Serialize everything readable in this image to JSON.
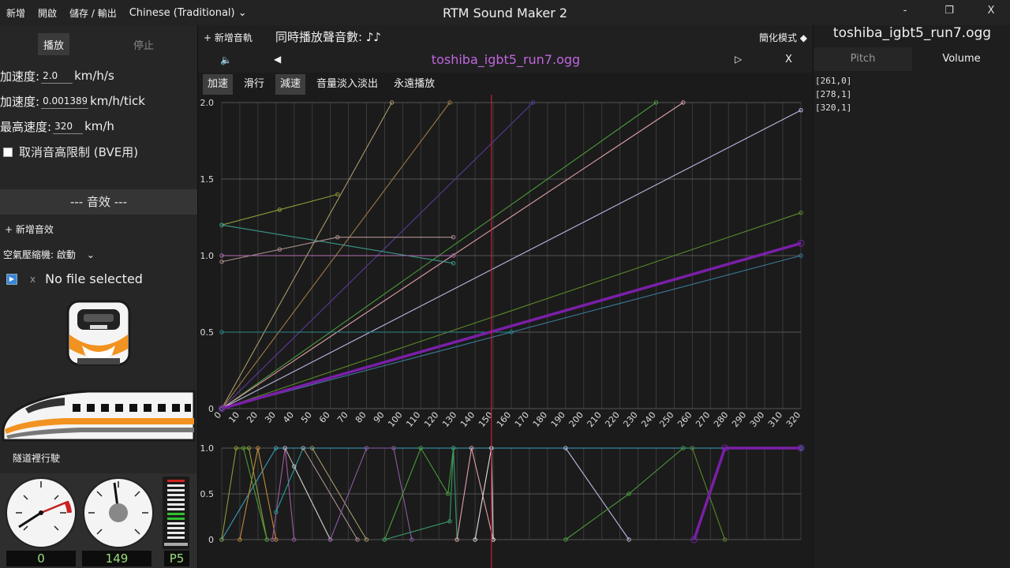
{
  "menu": {
    "new": "新增",
    "open": "開啟",
    "save": "儲存 / 輸出",
    "language": "Chinese (Traditional)"
  },
  "app_title": "RTM Sound Maker 2",
  "window": {
    "minimize": "-",
    "maximize": "❐",
    "close": "X"
  },
  "left": {
    "play": "播放",
    "stop": "停止",
    "accel_label": "加速度:",
    "accel_value": "2.0",
    "accel_unit": "km/h/s",
    "accel_tick_label": "加速度:",
    "accel_tick_value": "0.001389",
    "accel_tick_unit": "km/h/tick",
    "max_speed_label": "最高速度:",
    "max_speed_value": "320",
    "max_speed_unit": "km/h",
    "pitch_limit_label": "取消音高限制 (BVE用)",
    "sfx_header": "--- 音效 ---",
    "add_sfx": "+ 新增音效",
    "sfx_select": "空氣壓縮機: 啟動",
    "file_x": "x",
    "no_file": "No file selected",
    "tunnel": "隧道裡行駛",
    "readouts": [
      "0",
      "149",
      "P5"
    ]
  },
  "center": {
    "add_track": "+ 新增音軌",
    "polyphony": "同時播放聲音數: ♪♪",
    "simple_mode": "簡化模式 ◆",
    "prev": "◀",
    "next": "▷",
    "close": "X",
    "file_title": "toshiba_igbt5_run7.ogg",
    "tabs": [
      "加速",
      "滑行",
      "減速",
      "音量淡入淡出",
      "永遠播放"
    ]
  },
  "right": {
    "title": "toshiba_igbt5_run7.ogg",
    "tab_pitch": "Pitch",
    "tab_volume": "Volume",
    "points": [
      "[261,0]",
      "[278,1]",
      "[320,1]"
    ]
  },
  "colors": {
    "highlight": "#7a1fa8",
    "cursor": "#c0203a",
    "title": "#c066e0"
  },
  "chart_data": [
    {
      "type": "line",
      "title": "",
      "xlabel": "",
      "ylabel": "",
      "xlim": [
        0,
        320
      ],
      "ylim": [
        0,
        2.0
      ],
      "x_ticks": [
        0,
        10,
        20,
        30,
        40,
        50,
        60,
        70,
        80,
        90,
        100,
        110,
        120,
        130,
        140,
        150,
        160,
        170,
        180,
        190,
        200,
        210,
        220,
        230,
        240,
        250,
        260,
        270,
        280,
        290,
        300,
        310,
        320
      ],
      "y_ticks": [
        0,
        0.5,
        1.0,
        1.5,
        2.0
      ],
      "cursor_x": 149,
      "series": [
        {
          "color": "#a89a6a",
          "points": [
            [
              0,
              0
            ],
            [
              94,
              2.0
            ]
          ]
        },
        {
          "color": "#a07848",
          "points": [
            [
              0,
              0
            ],
            [
              126,
              2.0
            ]
          ]
        },
        {
          "color": "#5a3a9a",
          "points": [
            [
              0,
              0
            ],
            [
              172,
              2.0
            ]
          ]
        },
        {
          "color": "#4a9a3a",
          "points": [
            [
              0,
              0
            ],
            [
              240,
              2.0
            ]
          ]
        },
        {
          "color": "#e0a0a8",
          "points": [
            [
              0,
              0
            ],
            [
              255,
              2.0
            ]
          ]
        },
        {
          "color": "#b8b8e0",
          "points": [
            [
              0,
              0
            ],
            [
              320,
              1.95
            ]
          ]
        },
        {
          "color": "#5a8a2a",
          "points": [
            [
              0,
              0
            ],
            [
              320,
              1.28
            ]
          ]
        },
        {
          "color": "#3a7a9a",
          "points": [
            [
              0,
              0
            ],
            [
              320,
              1.0
            ]
          ]
        },
        {
          "color": "#2a8a8a",
          "points": [
            [
              0,
              0.5
            ],
            [
              160,
              0.5
            ]
          ]
        },
        {
          "color": "#8a9a3a",
          "points": [
            [
              0,
              1.2
            ],
            [
              32,
              1.3
            ],
            [
              64,
              1.4
            ]
          ]
        },
        {
          "color": "#3a9a8a",
          "points": [
            [
              0,
              1.2
            ],
            [
              128,
              0.95
            ]
          ]
        },
        {
          "color": "#b09090",
          "points": [
            [
              0,
              0.96
            ],
            [
              32,
              1.04
            ],
            [
              64,
              1.12
            ],
            [
              128,
              1.12
            ]
          ]
        },
        {
          "color": "#b070b0",
          "points": [
            [
              0,
              1.0
            ],
            [
              128,
              1.0
            ]
          ]
        },
        {
          "color": "#7a1fa8",
          "width": 3.5,
          "points": [
            [
              0,
              0
            ],
            [
              320,
              1.08
            ]
          ]
        }
      ]
    },
    {
      "type": "line",
      "title": "",
      "xlim": [
        0,
        320
      ],
      "ylim": [
        0,
        1.0
      ],
      "y_ticks": [
        0,
        0.5,
        1.0
      ],
      "series": [
        {
          "color": "#3aa0c0",
          "points": [
            [
              0,
              0
            ],
            [
              30,
              1.0
            ],
            [
              320,
              1.0
            ]
          ]
        },
        {
          "color": "#8a9a3a",
          "points": [
            [
              0,
              0
            ],
            [
              8,
              1.0
            ],
            [
              15,
              1.0
            ],
            [
              25,
              0
            ]
          ]
        },
        {
          "color": "#c08a3a",
          "points": [
            [
              10,
              0
            ],
            [
              20,
              1.0
            ],
            [
              30,
              0
            ]
          ]
        },
        {
          "color": "#4a9a3a",
          "points": [
            [
              12,
              1.0
            ],
            [
              25,
              0
            ]
          ]
        },
        {
          "color": "#a05aa0",
          "points": [
            [
              28,
              0
            ],
            [
              35,
              1.0
            ],
            [
              40,
              0
            ]
          ]
        },
        {
          "color": "#b0b0b0",
          "points": [
            [
              35,
              1.0
            ],
            [
              60,
              0
            ]
          ]
        },
        {
          "color": "#2aa0a0",
          "points": [
            [
              30,
              0.3
            ],
            [
              45,
              1.0
            ]
          ]
        },
        {
          "color": "#c0c0c0",
          "points": [
            [
              40,
              0.8
            ],
            [
              60,
              0
            ]
          ]
        },
        {
          "color": "#b09090",
          "points": [
            [
              45,
              1.0
            ],
            [
              75,
              0
            ]
          ]
        },
        {
          "color": "#a89a6a",
          "points": [
            [
              50,
              1.0
            ],
            [
              80,
              0
            ]
          ]
        },
        {
          "color": "#8a5aa0",
          "points": [
            [
              60,
              0
            ],
            [
              80,
              1.0
            ],
            [
              95,
              1.0
            ],
            [
              105,
              0
            ]
          ]
        },
        {
          "color": "#4a9a3a",
          "points": [
            [
              90,
              0
            ],
            [
              110,
              1.0
            ],
            [
              125,
              0.5
            ],
            [
              128,
              1.0
            ]
          ]
        },
        {
          "color": "#3a9a6a",
          "points": [
            [
              90,
              0
            ],
            [
              126,
              0.2
            ],
            [
              128,
              1.0
            ],
            [
              130,
              0
            ]
          ]
        },
        {
          "color": "#e0a0a8",
          "points": [
            [
              130,
              0
            ],
            [
              138,
              1.0
            ],
            [
              150,
              0
            ]
          ]
        },
        {
          "color": "#e0e0e0",
          "points": [
            [
              140,
              0
            ],
            [
              149,
              1.0
            ],
            [
              150,
              0
            ]
          ]
        },
        {
          "color": "#b8b8e0",
          "points": [
            [
              190,
              1.0
            ],
            [
              225,
              0
            ]
          ]
        },
        {
          "color": "#4a9a3a",
          "points": [
            [
              190,
              0
            ],
            [
              225,
              0.5
            ],
            [
              255,
              1.0
            ]
          ]
        },
        {
          "color": "#5a8a2a",
          "points": [
            [
              260,
              1.0
            ],
            [
              278,
              0
            ]
          ]
        },
        {
          "color": "#7a1fa8",
          "width": 3.5,
          "points": [
            [
              261,
              0
            ],
            [
              278,
              1.0
            ],
            [
              320,
              1.0
            ]
          ]
        }
      ]
    }
  ]
}
